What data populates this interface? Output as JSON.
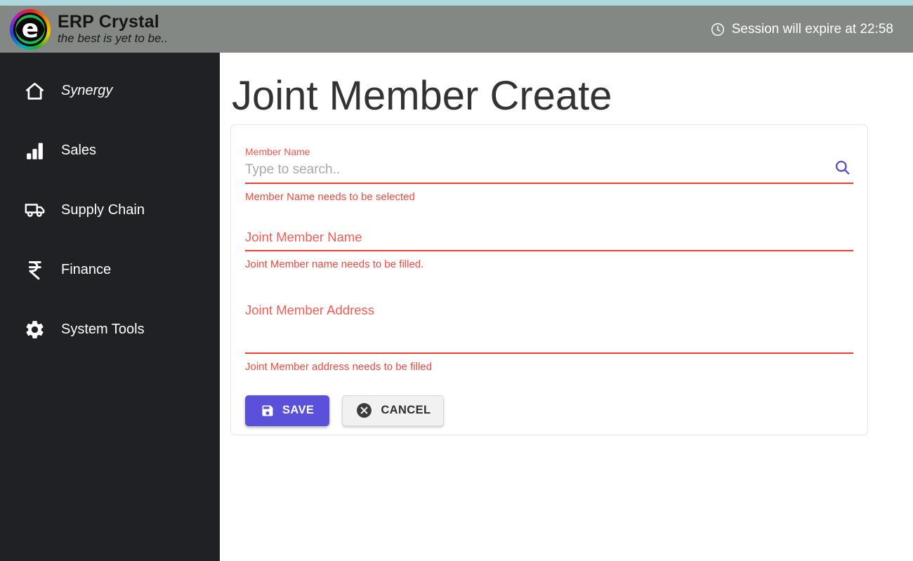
{
  "header": {
    "logo_letter": "e",
    "brand": "ERP Crystal",
    "tagline": "the best is yet to be..",
    "session_note": "Session will expire at 22:58"
  },
  "sidebar": {
    "items": [
      {
        "label": "Synergy",
        "icon": "home-icon"
      },
      {
        "label": "Sales",
        "icon": "bar-chart-icon"
      },
      {
        "label": "Supply Chain",
        "icon": "truck-icon"
      },
      {
        "label": "Finance",
        "icon": "rupee-icon"
      },
      {
        "label": "System Tools",
        "icon": "gear-icon"
      }
    ]
  },
  "main": {
    "title": "Joint Member Create",
    "form": {
      "member_name": {
        "label": "Member Name",
        "placeholder": "Type to search..",
        "value": "",
        "error": "Member Name needs to be selected"
      },
      "joint_member_name": {
        "label": "Joint Member Name",
        "value": "",
        "error": "Joint Member name needs to be filled."
      },
      "joint_member_address": {
        "label": "Joint Member Address",
        "value": "",
        "error": "Joint Member address needs to be filled"
      },
      "save_label": "SAVE",
      "cancel_label": "CANCEL"
    }
  },
  "colors": {
    "accent": "#5a50da",
    "error_red": "#f33b30",
    "header_bg": "#838884",
    "top_strip": "#aed8e0",
    "sidebar_bg": "#202124",
    "search_icon": "#5348d2"
  }
}
